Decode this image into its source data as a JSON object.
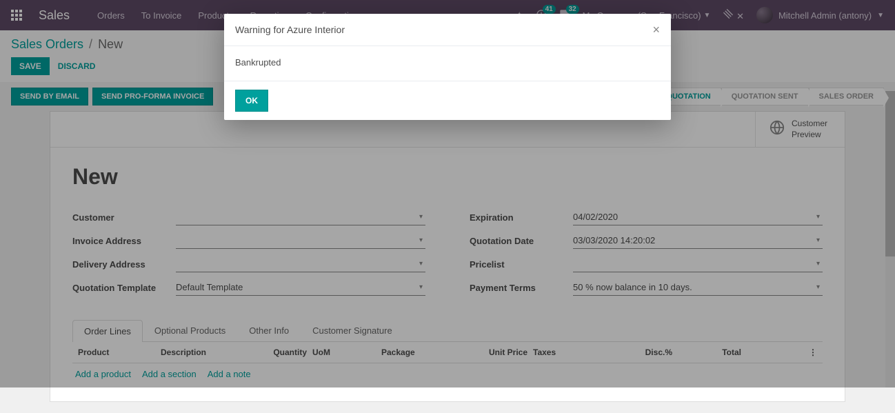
{
  "navbar": {
    "brand": "Sales",
    "menu": [
      "Orders",
      "To Invoice",
      "Products",
      "Reporting",
      "Configuration"
    ],
    "badge_activities": "41",
    "badge_messages": "32",
    "company": "My Company (San Francisco)",
    "user": "Mitchell Admin (antony)"
  },
  "breadcrumb": {
    "root": "Sales Orders",
    "current": "New"
  },
  "actions": {
    "save": "SAVE",
    "discard": "DISCARD"
  },
  "statusbar": {
    "send_email": "SEND BY EMAIL",
    "send_proforma": "SEND PRO-FORMA INVOICE",
    "steps": [
      "QUOTATION",
      "QUOTATION SENT",
      "SALES ORDER"
    ],
    "active_step": 0
  },
  "button_box": {
    "customer_preview": "Customer\nPreview"
  },
  "form": {
    "title": "New",
    "labels": {
      "customer": "Customer",
      "invoice_address": "Invoice Address",
      "delivery_address": "Delivery Address",
      "quotation_template": "Quotation Template",
      "expiration": "Expiration",
      "quotation_date": "Quotation Date",
      "pricelist": "Pricelist",
      "payment_terms": "Payment Terms"
    },
    "values": {
      "customer": "",
      "invoice_address": "",
      "delivery_address": "",
      "quotation_template": "Default Template",
      "expiration": "04/02/2020",
      "quotation_date": "03/03/2020 14:20:02",
      "pricelist": "",
      "payment_terms": "50 % now balance in 10 days."
    }
  },
  "tabs": [
    "Order Lines",
    "Optional Products",
    "Other Info",
    "Customer Signature"
  ],
  "table": {
    "headers": {
      "product": "Product",
      "description": "Description",
      "quantity": "Quantity",
      "uom": "UoM",
      "package": "Package",
      "unit_price": "Unit Price",
      "taxes": "Taxes",
      "disc": "Disc.%",
      "total": "Total"
    },
    "add_links": {
      "product": "Add a product",
      "section": "Add a section",
      "note": "Add a note"
    }
  },
  "modal": {
    "title": "Warning for Azure Interior",
    "body": "Bankrupted",
    "ok": "OK"
  }
}
